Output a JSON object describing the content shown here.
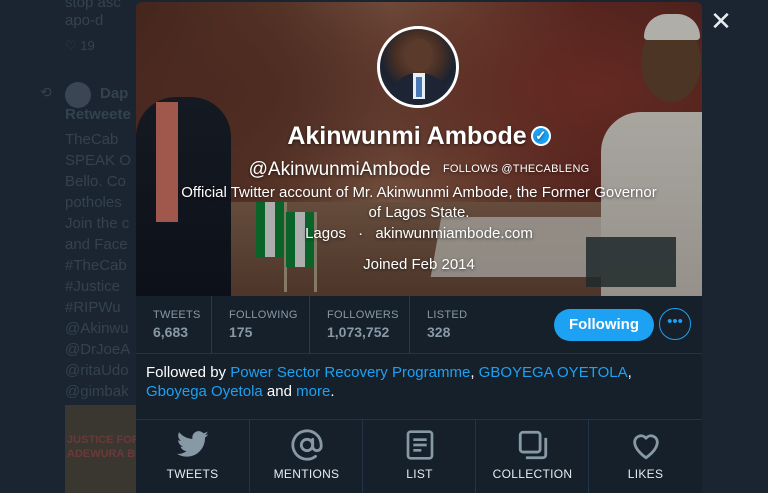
{
  "background": {
    "retweeted_label": "Retweete",
    "name_fragment": "Dap",
    "stats_fragment": "19",
    "lines": [
      "stop asc",
      "apo-d",
      "TheCab",
      "SPEAK O",
      "Bello. Co",
      "potholes",
      "Join the c",
      "and Face",
      "#TheCab",
      "#Justice",
      "#RIPWu",
      "@Akinwu",
      "@DrJoeA",
      "@ritaUdo",
      "@gimbak"
    ],
    "image_text": "JUSTICE FOR\nADEWURA BI"
  },
  "profile": {
    "name": "Akinwunmi Ambode",
    "verified_icon": "verified-badge-icon",
    "handle": "@AkinwunmiAmbode",
    "follows_you": "FOLLOWS @THECABLENG",
    "bio": "Official Twitter account of Mr. Akinwunmi Ambode, the Former Governor of Lagos State.",
    "location": "Lagos",
    "separator": "·",
    "website": "akinwunmiambode.com",
    "joined": "Joined Feb 2014"
  },
  "stats": [
    {
      "label": "TWEETS",
      "value": "6,683"
    },
    {
      "label": "FOLLOWING",
      "value": "175"
    },
    {
      "label": "FOLLOWERS",
      "value": "1,073,752"
    },
    {
      "label": "LISTED",
      "value": "328"
    }
  ],
  "actions": {
    "follow_label": "Following",
    "more_label": "•••"
  },
  "followed_by": {
    "prefix": "Followed by ",
    "accounts": [
      "Power Sector Recovery Programme",
      "GBOYEGA OYETOLA",
      "Gboyega Oyetola"
    ],
    "sep1": ", ",
    "sep2": ", ",
    "and": " and ",
    "more": "more",
    "end": "."
  },
  "bottom_nav": [
    {
      "label": "TWEETS",
      "icon": "twitter-bird-icon"
    },
    {
      "label": "MENTIONS",
      "icon": "at-sign-icon"
    },
    {
      "label": "LIST",
      "icon": "list-icon"
    },
    {
      "label": "COLLECTION",
      "icon": "collection-icon"
    },
    {
      "label": "LIKES",
      "icon": "heart-icon"
    }
  ],
  "close_label": "✕",
  "colors": {
    "accent": "#1da1f2",
    "card_bg": "#15202b",
    "muted_text": "#8899a6"
  }
}
